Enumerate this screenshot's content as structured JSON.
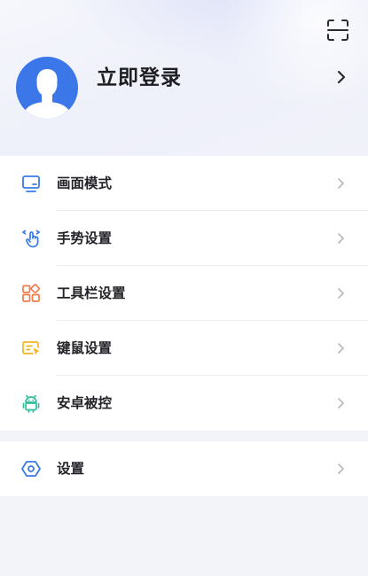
{
  "profile": {
    "login_label": "立即登录"
  },
  "menu_main": [
    {
      "id": "display-mode",
      "label": "画面模式",
      "icon": "monitor-icon",
      "color": "#3a7be6"
    },
    {
      "id": "gesture-settings",
      "label": "手势设置",
      "icon": "hand-gesture-icon",
      "color": "#3a7be6"
    },
    {
      "id": "toolbar-settings",
      "label": "工具栏设置",
      "icon": "grid-apps-icon",
      "color": "#ef7d4a"
    },
    {
      "id": "keyboard-mouse-settings",
      "label": "键鼠设置",
      "icon": "keyboard-mouse-icon",
      "color": "#f2b51f"
    },
    {
      "id": "android-control",
      "label": "安卓被控",
      "icon": "android-icon",
      "color": "#2fbf9c"
    }
  ],
  "menu_secondary": [
    {
      "id": "settings",
      "label": "设置",
      "icon": "settings-hexagon-icon",
      "color": "#3a7be6"
    }
  ],
  "colors": {
    "accent_blue": "#3a7be6",
    "avatar_bg": "#3b77e8",
    "background": "#f3f4f9",
    "card": "#ffffff"
  }
}
